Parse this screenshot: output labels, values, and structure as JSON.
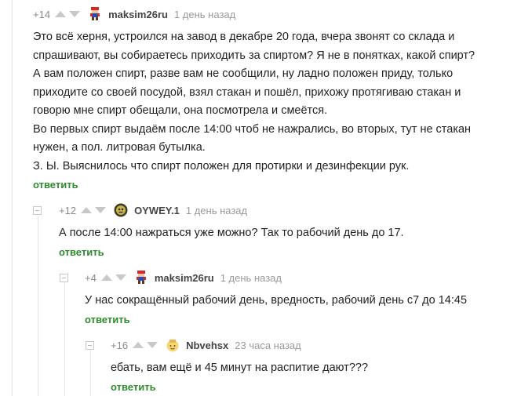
{
  "comments": [
    {
      "rating": "+14",
      "author": "maksim26ru",
      "time": "1 день назад",
      "avatar_icon": "mario-avatar-icon",
      "body": "Это всё херня, устроился на завод в декабре 20 года, вчера звонят со склада и\nспрашивают, вы собираетесь приходить за спиртом? Я не в понятках, какой спирт?\nА вам положен спирт, разве вам не сообщили, ну ладно положен приду, только\nприходите со своей посудой, взял стакан и пошёл, прихожу протягиваю стакан и\nговорю мне спирт обещали, она посмотрела и смеётся.\nВо первых спирт выдаём после 14:00 чтоб не нажрались, во вторых, тут не стакан\nнужен, а пол. литровая бутылка.\nЗ. Ы. Выяснилось что спирт положен для протирки и дезинфекции рук.",
      "reply": "ответить"
    },
    {
      "rating": "+12",
      "author": "OYWEY.1",
      "time": "1 день назад",
      "avatar_icon": "round-face-avatar-icon",
      "body": "А после 14:00 нажраться уже можно? Так то рабочий день до 17.",
      "reply": "ответить"
    },
    {
      "rating": "+4",
      "author": "maksim26ru",
      "time": "1 день назад",
      "avatar_icon": "mario-avatar-icon",
      "body": "У нас сокращённый рабочий день, вредность, рабочий день с7 до 14:45",
      "reply": "ответить"
    },
    {
      "rating": "+16",
      "author": "Nbvehsx",
      "time": "23 часа назад",
      "avatar_icon": "yellow-creature-avatar-icon",
      "body": "ебать, вам ещё и 45 минут на распитие дают???",
      "reply": "ответить"
    }
  ]
}
